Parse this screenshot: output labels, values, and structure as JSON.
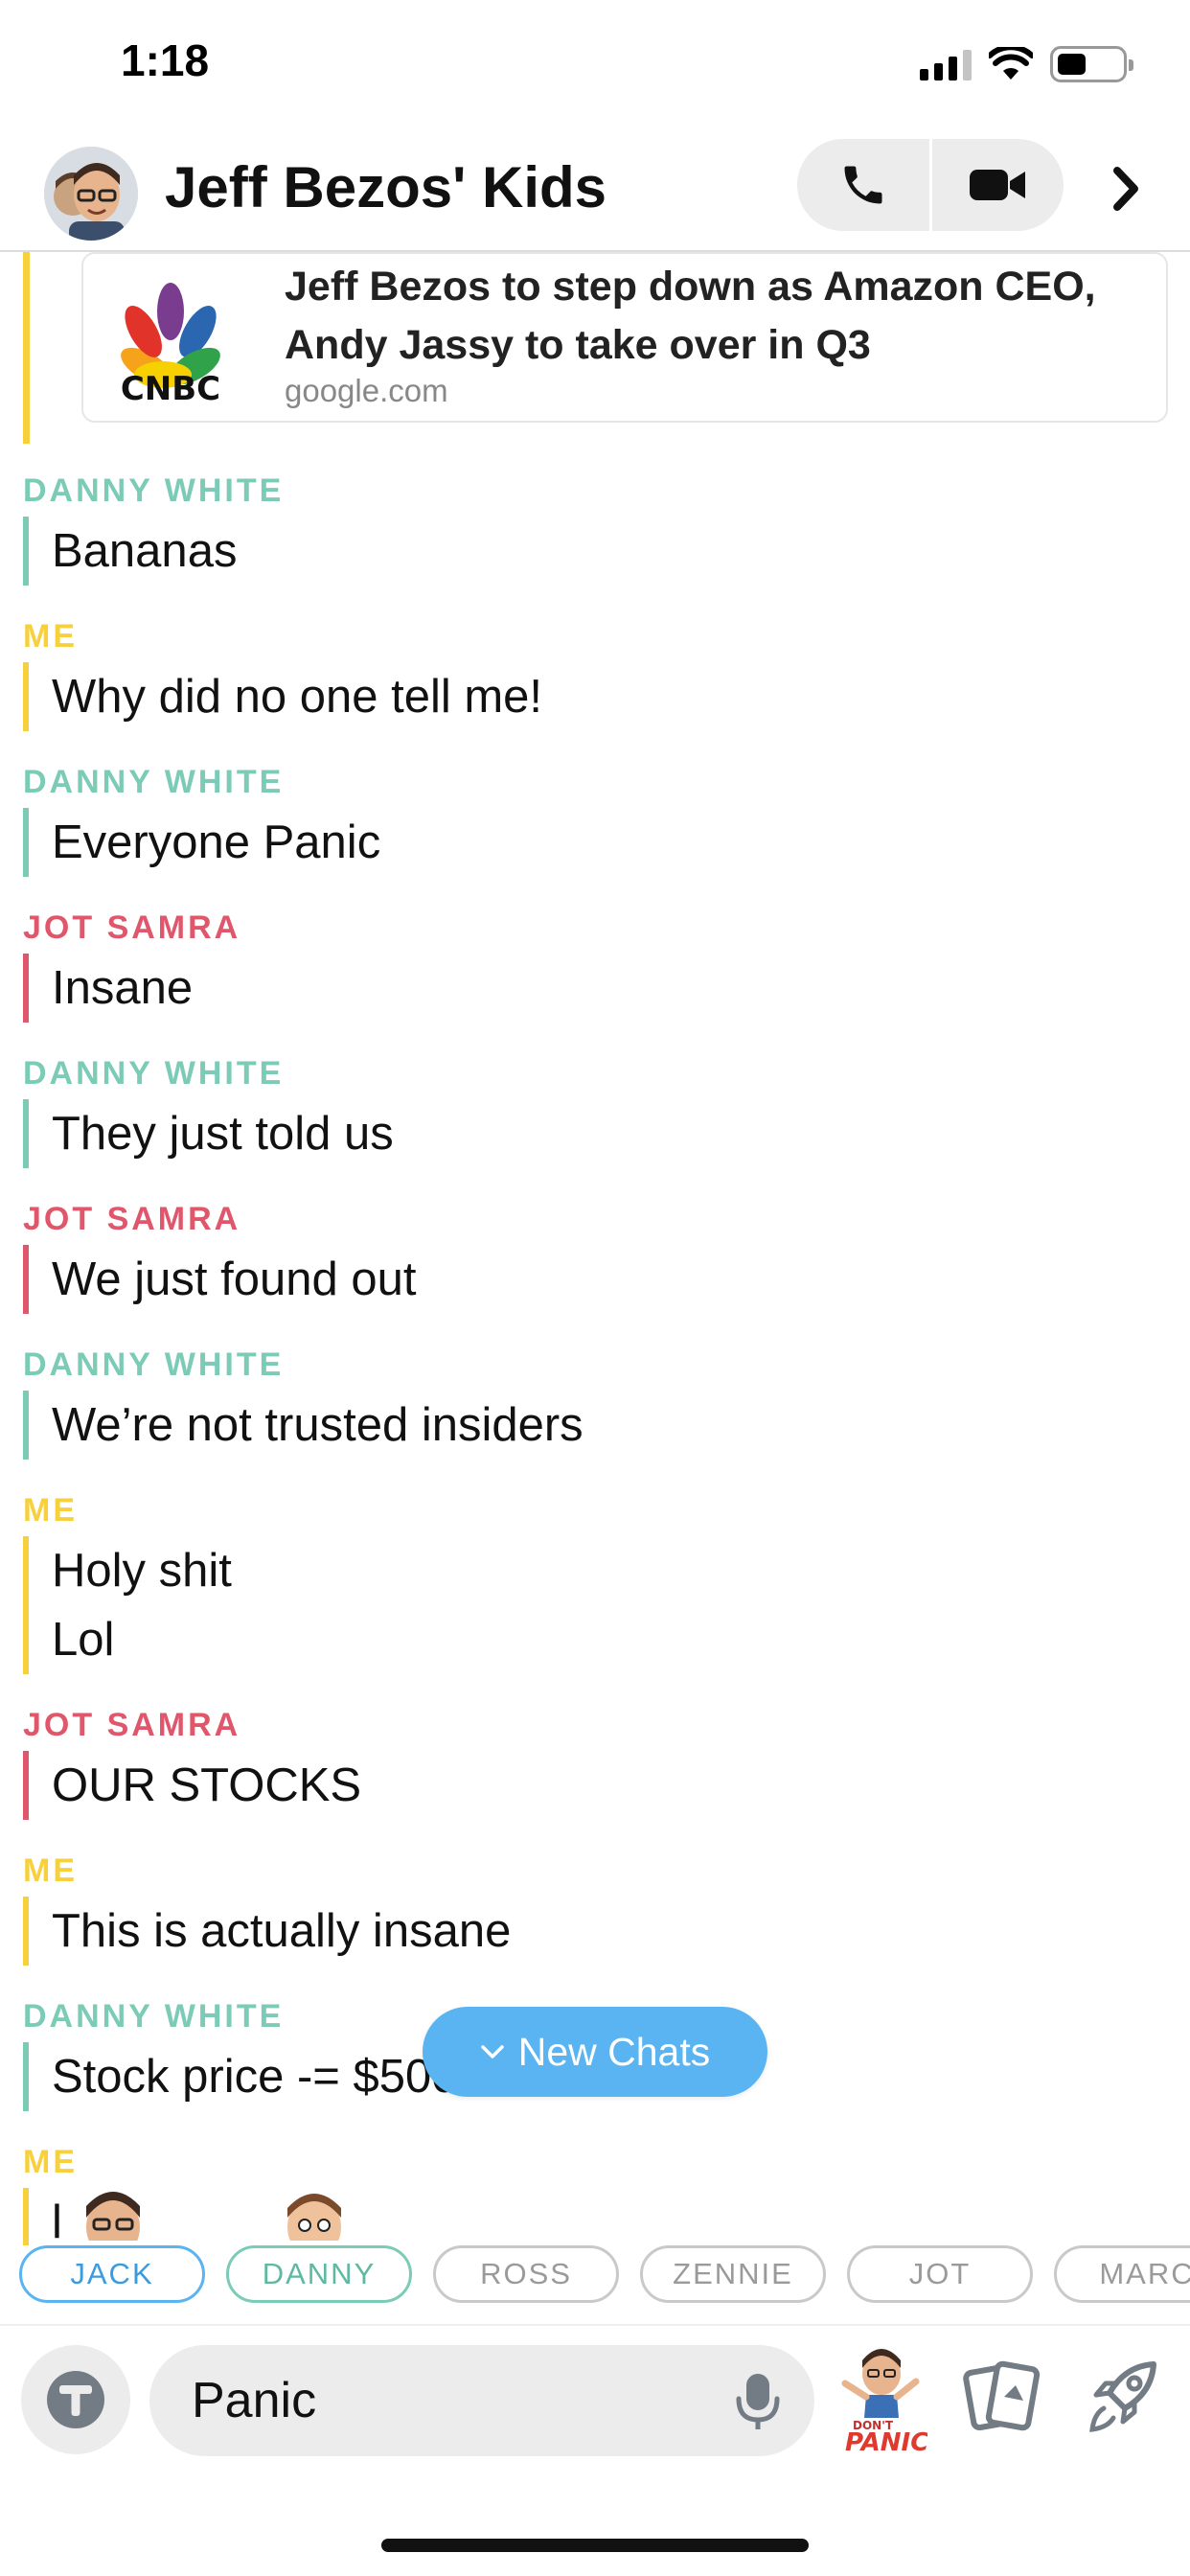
{
  "status_bar": {
    "time": "1:18"
  },
  "header": {
    "title": "Jeff Bezos' Kids",
    "avatar_icon": "bitmoji-avatar-icon",
    "voice_call_icon": "phone-icon",
    "video_call_icon": "video-camera-icon",
    "more_icon": "chevron-right-icon"
  },
  "link_card": {
    "logo_text": "CNBC",
    "title": "Jeff Bezos to step down as Amazon CEO, Andy Jassy to take over in Q3",
    "domain": "google.com"
  },
  "messages": [
    {
      "sender": "DANNY WHITE",
      "lines": [
        "Bananas"
      ]
    },
    {
      "sender": "ME",
      "lines": [
        "Why did no one tell me!"
      ]
    },
    {
      "sender": "DANNY WHITE",
      "lines": [
        "Everyone Panic"
      ]
    },
    {
      "sender": "JOT SAMRA",
      "lines": [
        "Insane"
      ]
    },
    {
      "sender": "DANNY WHITE",
      "lines": [
        "They just told us"
      ]
    },
    {
      "sender": "JOT SAMRA",
      "lines": [
        "We just found out"
      ]
    },
    {
      "sender": "DANNY WHITE",
      "lines": [
        "We’re not trusted insiders"
      ]
    },
    {
      "sender": "ME",
      "lines": [
        "Holy shit",
        "Lol"
      ]
    },
    {
      "sender": "JOT SAMRA",
      "lines": [
        "OUR STOCKS"
      ]
    },
    {
      "sender": "ME",
      "lines": [
        "This is actually insane"
      ]
    },
    {
      "sender": "DANNY WHITE",
      "lines": [
        "Stock price -= $500"
      ]
    },
    {
      "sender": "ME",
      "lines": [
        "l"
      ]
    }
  ],
  "new_chats_button": {
    "label": "New Chats",
    "icon": "chevron-down-icon"
  },
  "friend_chips": [
    "JACK",
    "DANNY",
    "ROSS",
    "ZENNIE",
    "JOT",
    "MARC"
  ],
  "composer": {
    "value": "Panic",
    "text_mode_icon": "text-t-icon",
    "mic_icon": "microphone-icon",
    "sticker_text_top": "DON'T",
    "sticker_text_bottom": "PANIC",
    "cards_icon": "cards-icon",
    "games_icon": "rocket-icon"
  },
  "colors": {
    "danny": "#7ccbb7",
    "me": "#f6d13d",
    "jot": "#e0566b",
    "new_chats": "#5ab4f1"
  }
}
